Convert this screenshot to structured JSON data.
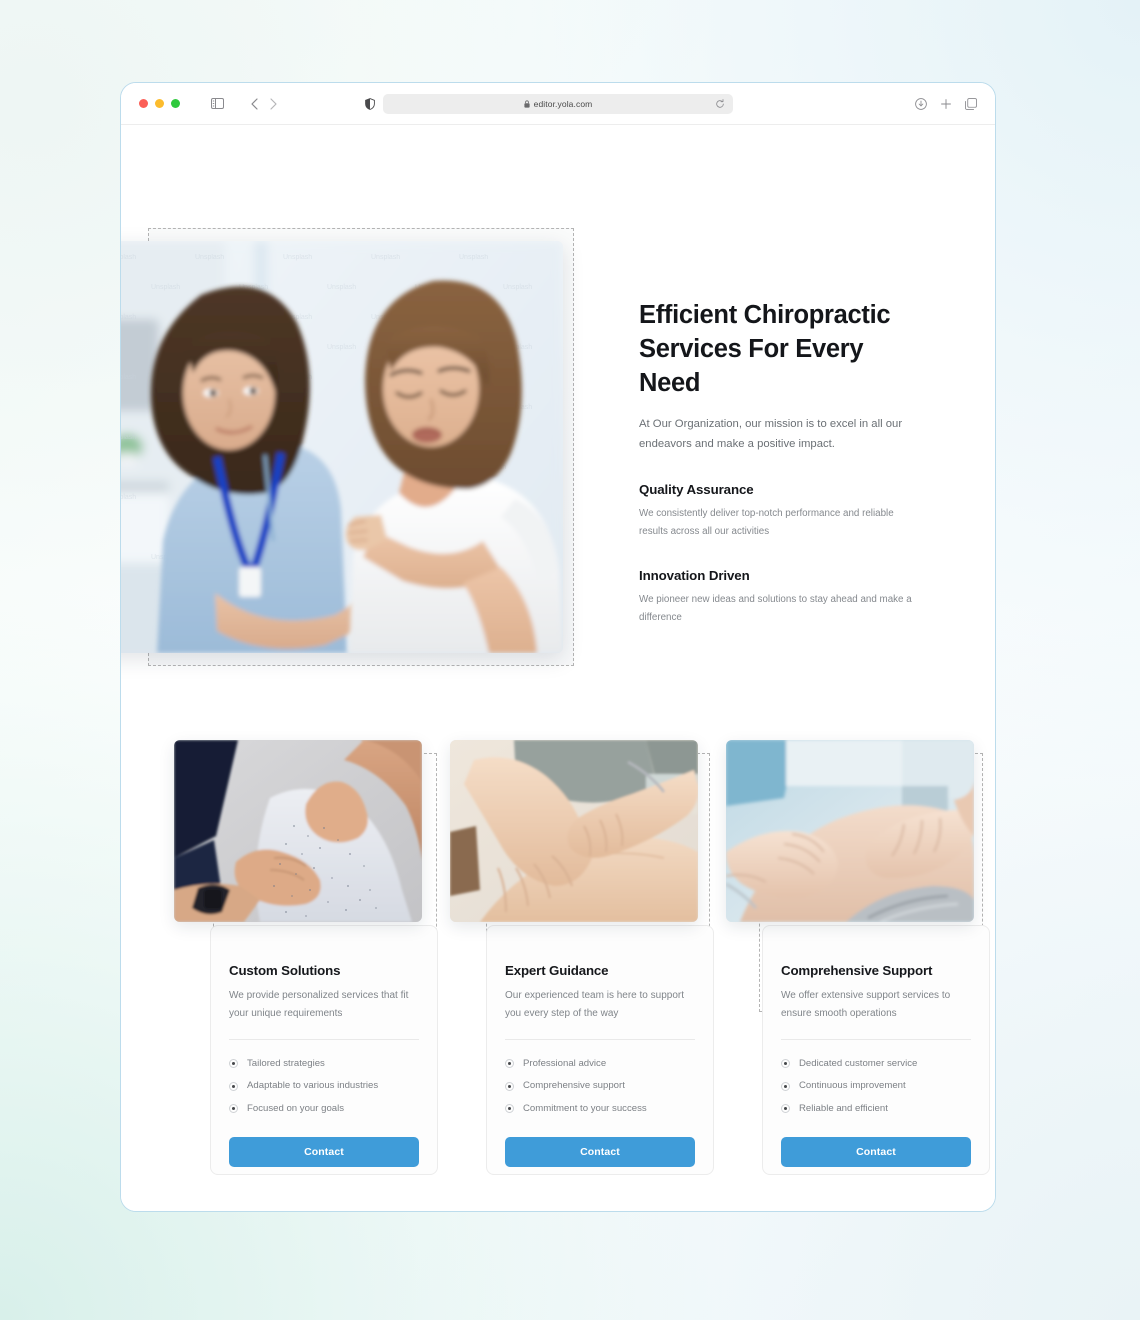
{
  "browser": {
    "traffic_lights": [
      "close",
      "minimize",
      "maximize"
    ],
    "url": "editor.yola.com",
    "lock_icon": "lock-icon",
    "sidebar_icon": "sidebar-toggle-icon",
    "back_icon": "back-arrow-icon",
    "forward_icon": "forward-arrow-icon",
    "shield_icon": "privacy-shield-icon",
    "reload_icon": "reload-icon",
    "download_icon": "download-icon",
    "new_tab_icon": "new-tab-plus-icon",
    "tabs_icon": "tab-overview-icon"
  },
  "hero": {
    "title": "Efficient Chiropractic Services For Every Need",
    "subtitle": "At Our Organization, our mission is to excel in all our endeavors and make a positive impact.",
    "image_alt": "chiropractor-examining-patient-shoulder",
    "features": [
      {
        "title": "Quality Assurance",
        "text": "We consistently deliver top-notch performance and reliable results across all our activities"
      },
      {
        "title": "Innovation Driven",
        "text": "We pioneer new ideas and solutions to stay ahead and make a difference"
      }
    ]
  },
  "cards": [
    {
      "title": "Custom Solutions",
      "desc": "We provide personalized services that fit your unique requirements",
      "image_alt": "hands-on-patient-shoulder",
      "items": [
        "Tailored strategies",
        "Adaptable to various industries",
        "Focused on your goals"
      ],
      "button": "Contact"
    },
    {
      "title": "Expert Guidance",
      "desc": "Our experienced team is here to support you every step of the way",
      "image_alt": "therapist-hands-on-back",
      "items": [
        "Professional advice",
        "Comprehensive support",
        "Commitment to your success"
      ],
      "button": "Contact"
    },
    {
      "title": "Comprehensive Support",
      "desc": "We offer extensive support services to ensure smooth operations",
      "image_alt": "shoulder-massage-treatment",
      "items": [
        "Dedicated customer service",
        "Continuous improvement",
        "Reliable and efficient"
      ],
      "button": "Contact"
    }
  ],
  "colors": {
    "accent_blue": "#3f9cd9",
    "window_border": "#bcdcec",
    "text_dark": "#14161a",
    "text_muted": "#80858a",
    "dashed_outline": "#b4b4b4"
  }
}
